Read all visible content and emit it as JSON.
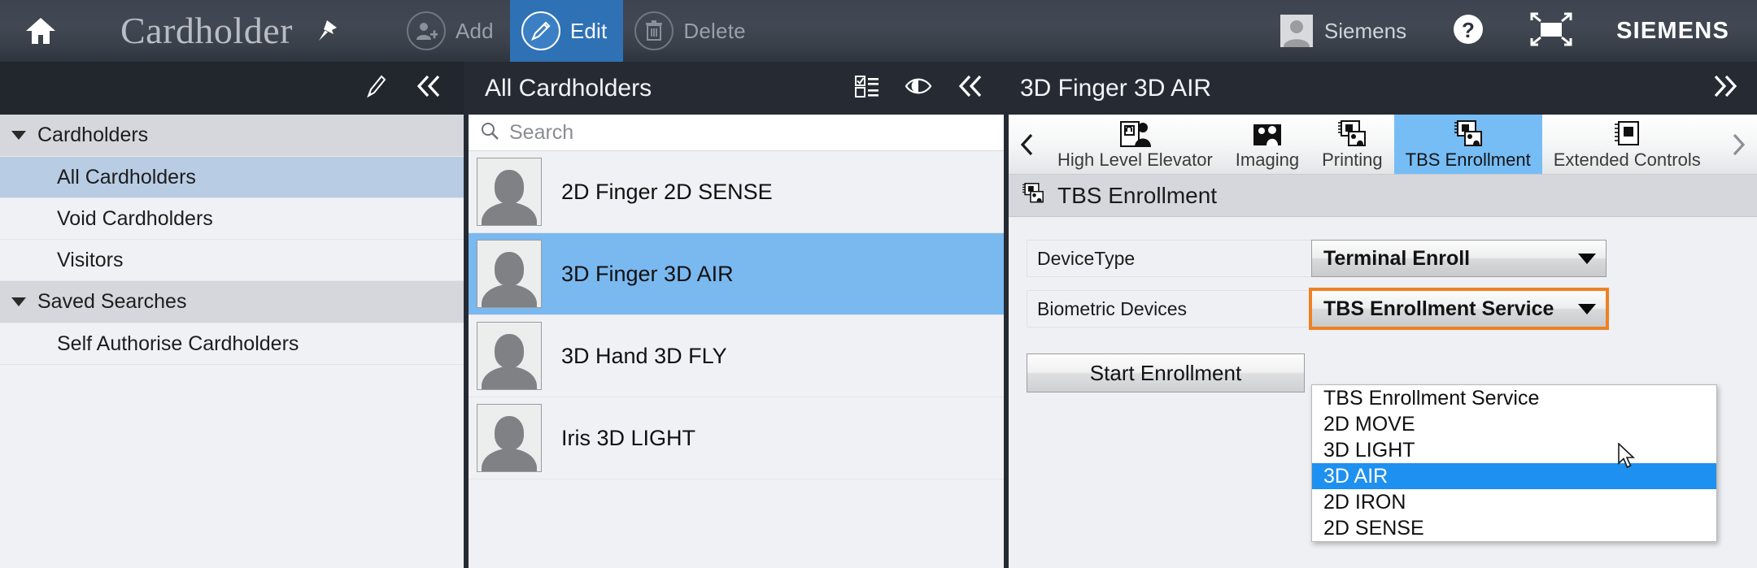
{
  "header": {
    "home_icon": "home-icon",
    "app_title": "Cardholder",
    "pin_icon": "pin-icon",
    "actions": [
      {
        "label": "Add",
        "icon": "add-user-icon",
        "active": false
      },
      {
        "label": "Edit",
        "icon": "pencil-icon",
        "active": true
      },
      {
        "label": "Delete",
        "icon": "trash-icon",
        "active": false
      }
    ],
    "user_name": "Siemens",
    "user_avatar_icon": "avatar-icon",
    "help_icon": "help-question-icon",
    "expand_icon": "fullscreen-icon",
    "brand": "SIEMENS"
  },
  "secondbar": {
    "edit_icon": "pencil-icon",
    "collapse_left_icon": "double-chevron-left-icon",
    "list_title": "All Cardholders",
    "checklist_icon": "checklist-icon",
    "eye_icon": "eye-icon",
    "collapse_mid_icon": "double-chevron-left-icon",
    "detail_title": "3D Finger 3D AIR",
    "expand_right_icon": "double-chevron-right-icon"
  },
  "sidebar": {
    "groups": [
      {
        "label": "Cardholders",
        "expanded": true,
        "items": [
          {
            "label": "All Cardholders",
            "selected": true
          },
          {
            "label": "Void Cardholders",
            "selected": false
          },
          {
            "label": "Visitors",
            "selected": false
          }
        ]
      },
      {
        "label": "Saved Searches",
        "expanded": true,
        "items": [
          {
            "label": "Self Authorise Cardholders",
            "selected": false
          }
        ]
      }
    ]
  },
  "list": {
    "search_placeholder": "Search",
    "search_value": "",
    "search_icon": "search-icon",
    "rows": [
      {
        "name": "2D Finger 2D SENSE",
        "selected": false
      },
      {
        "name": "3D Finger 3D AIR",
        "selected": true
      },
      {
        "name": "3D Hand 3D FLY",
        "selected": false
      },
      {
        "name": "Iris 3D LIGHT",
        "selected": false
      }
    ]
  },
  "detail": {
    "tab_prev_icon": "chevron-left-icon",
    "tab_next_icon": "chevron-right-icon",
    "tabs": [
      {
        "label": "High Level Elevator",
        "icon": "elevator-access-icon",
        "active": false
      },
      {
        "label": "Imaging",
        "icon": "imaging-icon",
        "active": false
      },
      {
        "label": "Printing",
        "icon": "printing-icon",
        "active": false
      },
      {
        "label": "TBS Enrollment",
        "icon": "tbs-enrollment-icon",
        "active": true
      },
      {
        "label": "Extended Controls",
        "icon": "extended-controls-icon",
        "active": false
      }
    ],
    "section_title": "TBS Enrollment",
    "section_icon": "tbs-enrollment-icon",
    "fields": [
      {
        "label": "DeviceType",
        "value": "Terminal Enroll",
        "focused": false
      },
      {
        "label": "Biometric Devices",
        "value": "TBS Enrollment Service",
        "focused": true
      }
    ],
    "start_button": "Start Enrollment",
    "dropdown": {
      "open": true,
      "options": [
        {
          "label": "TBS Enrollment Service",
          "highlighted": false
        },
        {
          "label": "2D MOVE",
          "highlighted": false
        },
        {
          "label": "3D LIGHT",
          "highlighted": false
        },
        {
          "label": "3D AIR",
          "highlighted": true
        },
        {
          "label": "2D IRON",
          "highlighted": false
        },
        {
          "label": "2D SENSE",
          "highlighted": false
        }
      ]
    }
  },
  "colors": {
    "accent_blue": "#2f71b5",
    "selection_blue": "#7ab8f0",
    "tree_selection": "#b8cce4",
    "focus_orange": "#ef8123",
    "dropdown_highlight": "#1e90f0",
    "dark_chrome": "#262b33"
  }
}
